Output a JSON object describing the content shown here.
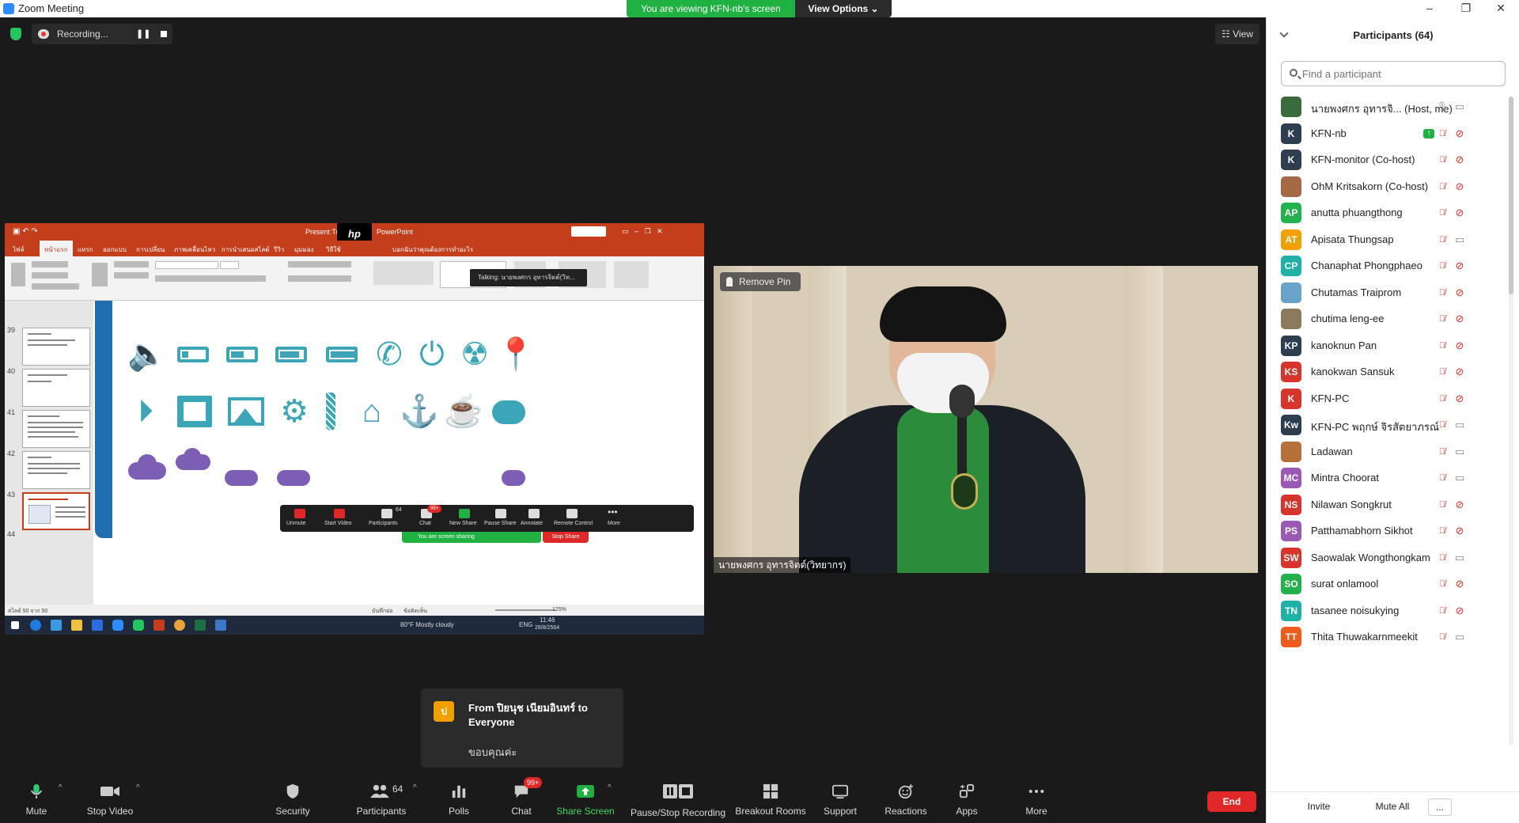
{
  "window": {
    "title": "Zoom Meeting",
    "minimize": "–",
    "restore": "❐",
    "close": "✕"
  },
  "banner": {
    "viewing": "You are viewing KFN-nb's screen",
    "view_options": "View Options ⌄"
  },
  "recording": {
    "label": "Recording...",
    "pause": "❚❚"
  },
  "view_button": "☷ View",
  "shared_screen": {
    "window_title": "Present Tra",
    "window_title_suffix": "PowerPoint",
    "tabs": [
      "ไฟล์",
      "หน้าแรก",
      "แทรก",
      "ออกแบบ",
      "การเปลี่ยน",
      "ภาพเคลื่อนไหว",
      "การนำเสนอสไลด์",
      "รีวิว",
      "มุมมอง",
      "วิธีใช้"
    ],
    "tell_me": "บอกฉันว่าคุณต้องการทำอะไร",
    "thumb_numbers": [
      "39",
      "40",
      "41",
      "42",
      "43",
      "44"
    ],
    "talking": "Talking: นายพงศกร อุทารจิตต์(วิท...",
    "share_toolbar": [
      "Unmute",
      "Start Video",
      "Participants",
      "Chat",
      "New Share",
      "Pause Share",
      "Annotate",
      "Remote Control",
      "More"
    ],
    "share_participants_count": "64",
    "share_chat_badge": "99+",
    "screen_sharing": "You are screen sharing",
    "stop_share": "Stop Share",
    "status_left": "สไลด์ 50 จาก 50",
    "status_notes": "บันทึกย่อ",
    "status_comments": "ข้อคิดเห็น",
    "zoom": "125%",
    "weather": "80°F  Mostly cloudy",
    "lang": "ENG",
    "time": "11:46",
    "date": "28/8/2564"
  },
  "pinned_video": {
    "remove_pin": "Remove Pin",
    "name": "นายพงศกร อุทารจิตต์(วิทยากร)"
  },
  "chat_notification": {
    "avatar": "ป",
    "from": "From ปิยนุช เนียมอินทร์ to Everyone",
    "message": "ขอบคุณค่ะ"
  },
  "toolbar": {
    "mute": "Mute",
    "stop_video": "Stop Video",
    "security": "Security",
    "participants": "Participants",
    "participants_count": "64",
    "polls": "Polls",
    "chat": "Chat",
    "chat_badge": "99+",
    "share_screen": "Share Screen",
    "pause_recording": "Pause/Stop Recording",
    "breakout": "Breakout Rooms",
    "support": "Support",
    "reactions": "Reactions",
    "apps": "Apps",
    "more": "More",
    "end": "End"
  },
  "panel": {
    "title": "Participants (64)",
    "search_placeholder": "Find a participant",
    "participants": [
      {
        "initials": "",
        "name": "นายพงศกร อุทารจิ...  (Host, me)",
        "color": "#3a6b3a",
        "mic": "on",
        "cam": "on"
      },
      {
        "initials": "K",
        "name": "KFN-nb",
        "color": "#2d3e50",
        "mic": "muted",
        "cam": "off",
        "sharing": true
      },
      {
        "initials": "K",
        "name": "KFN-monitor (Co-host)",
        "color": "#2d3e50",
        "mic": "muted",
        "cam": "off"
      },
      {
        "initials": "",
        "name": "OhM Kritsakorn (Co-host)",
        "color": "#a56a45",
        "mic": "muted",
        "cam": "off"
      },
      {
        "initials": "AP",
        "name": "anutta phuangthong",
        "color": "#22b14c",
        "mic": "muted",
        "cam": "off"
      },
      {
        "initials": "AT",
        "name": "Apisata Thungsap",
        "color": "#f0a000",
        "mic": "muted",
        "cam": "on"
      },
      {
        "initials": "CP",
        "name": "Chanaphat Phongphaeo",
        "color": "#1fb1a5",
        "mic": "muted",
        "cam": "off"
      },
      {
        "initials": "",
        "name": "Chutamas Traiprom",
        "color": "#6aa3c8",
        "mic": "muted",
        "cam": "off"
      },
      {
        "initials": "",
        "name": "chutima leng-ee",
        "color": "#8a7a5a",
        "mic": "muted",
        "cam": "off"
      },
      {
        "initials": "KP",
        "name": "kanoknun Pan",
        "color": "#2d3e50",
        "mic": "muted",
        "cam": "off"
      },
      {
        "initials": "KS",
        "name": "kanokwan Sansuk",
        "color": "#d9342b",
        "mic": "muted",
        "cam": "off"
      },
      {
        "initials": "K",
        "name": "KFN-PC",
        "color": "#d9342b",
        "mic": "muted",
        "cam": "off"
      },
      {
        "initials": "Kw",
        "name": "KFN-PC พฤกษ์ จิรสัตยาภรณ์",
        "color": "#2d3e50",
        "mic": "muted",
        "cam": "on"
      },
      {
        "initials": "",
        "name": "Ladawan",
        "color": "#b8703a",
        "mic": "muted",
        "cam": "on"
      },
      {
        "initials": "MC",
        "name": "Mintra Choorat",
        "color": "#9b59b6",
        "mic": "muted",
        "cam": "on"
      },
      {
        "initials": "NS",
        "name": "Nilawan Songkrut",
        "color": "#d9342b",
        "mic": "muted",
        "cam": "off"
      },
      {
        "initials": "PS",
        "name": "Patthamabhorn Sikhot",
        "color": "#9b59b6",
        "mic": "muted",
        "cam": "off"
      },
      {
        "initials": "SW",
        "name": "Saowalak Wongthongkam",
        "color": "#d9342b",
        "mic": "muted",
        "cam": "on"
      },
      {
        "initials": "SO",
        "name": "surat onlamool",
        "color": "#22b14c",
        "mic": "muted",
        "cam": "off"
      },
      {
        "initials": "TN",
        "name": "tasanee noisukying",
        "color": "#1fb1a5",
        "mic": "muted",
        "cam": "off"
      },
      {
        "initials": "TT",
        "name": "Thita Thuwakarnmeekit",
        "color": "#f05a1a",
        "mic": "muted",
        "cam": "on"
      }
    ],
    "invite": "Invite",
    "mute_all": "Mute All",
    "more": "..."
  },
  "colors": {
    "green": "#1fb141",
    "red": "#e02828",
    "blue": "#2d8cff"
  }
}
